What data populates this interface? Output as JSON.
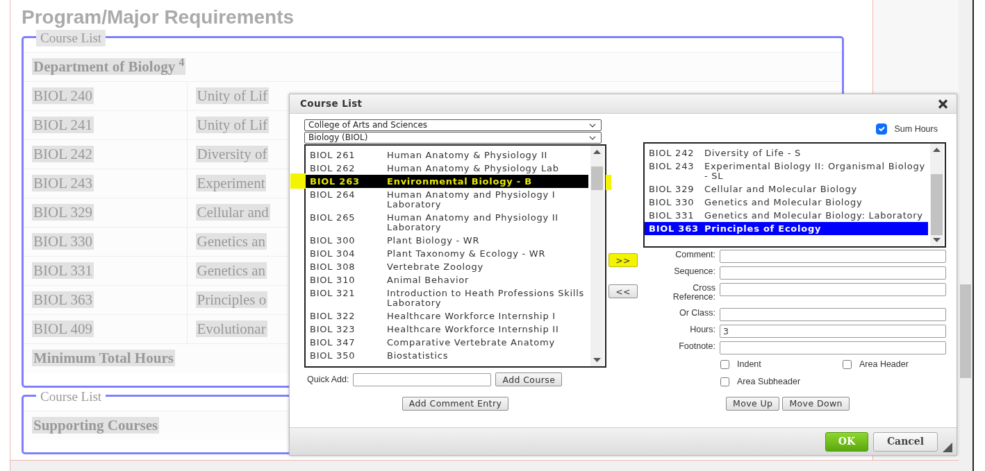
{
  "page": {
    "title": "Program/Major Requirements",
    "sections": [
      {
        "legend": "Course List",
        "heading": "Department of Biology $^{4}$",
        "rows": [
          {
            "code": "BIOL 240",
            "title": "Unity of Lif"
          },
          {
            "code": "BIOL 241",
            "title": "Unity of Lif"
          },
          {
            "code": "BIOL 242",
            "title": "Diversity of"
          },
          {
            "code": "BIOL 243",
            "title": "Experiment"
          },
          {
            "code": "BIOL 329",
            "title": "Cellular and"
          },
          {
            "code": "BIOL 330",
            "title": "Genetics an"
          },
          {
            "code": "BIOL 331",
            "title": "Genetics an"
          },
          {
            "code": "BIOL 363",
            "title": "Principles o"
          },
          {
            "code": "BIOL 409",
            "title": "Evolutionar"
          }
        ],
        "total_label": "Minimum Total Hours"
      },
      {
        "legend": "Course List",
        "heading": "Supporting Courses"
      }
    ]
  },
  "dialog": {
    "title": "Course List",
    "college_select": "College of Arts and Sciences",
    "department_select": "Biology (BIOL)",
    "sum_hours": {
      "label": "Sum Hours",
      "checked": true
    },
    "available_courses": [
      {
        "code": "BIOL 261",
        "title": "Human Anatomy & Physiology II",
        "selected": false
      },
      {
        "code": "BIOL 262",
        "title": "Human Anatomy & Physiology Lab",
        "selected": false
      },
      {
        "code": "BIOL 263",
        "title": "Environmental Biology - B",
        "selected": true
      },
      {
        "code": "BIOL 264",
        "title": "Human Anatomy and Physiology I Laboratory",
        "selected": false
      },
      {
        "code": "BIOL 265",
        "title": "Human Anatomy and Physiology II Laboratory",
        "selected": false
      },
      {
        "code": "BIOL 300",
        "title": "Plant Biology - WR",
        "selected": false
      },
      {
        "code": "BIOL 304",
        "title": "Plant Taxonomy & Ecology - WR",
        "selected": false
      },
      {
        "code": "BIOL 308",
        "title": "Vertebrate Zoology",
        "selected": false
      },
      {
        "code": "BIOL 310",
        "title": "Animal Behavior",
        "selected": false
      },
      {
        "code": "BIOL 321",
        "title": "Introduction to Heath Professions Skills Laboratory",
        "selected": false
      },
      {
        "code": "BIOL 322",
        "title": "Healthcare Workforce Internship I",
        "selected": false
      },
      {
        "code": "BIOL 323",
        "title": "Healthcare Workforce Internship II",
        "selected": false
      },
      {
        "code": "BIOL 347",
        "title": "Comparative Vertebrate Anatomy",
        "selected": false
      },
      {
        "code": "BIOL 350",
        "title": "Biostatistics",
        "selected": false
      }
    ],
    "add_button": ">>",
    "remove_button": "<<",
    "chosen_courses": [
      {
        "code": "BIOL 242",
        "title": "Diversity of Life - S",
        "selected": false
      },
      {
        "code": "BIOL 243",
        "title": "Experimental Biology II: Organismal Biology - SL",
        "selected": false
      },
      {
        "code": "BIOL 329",
        "title": "Cellular and Molecular Biology",
        "selected": false
      },
      {
        "code": "BIOL 330",
        "title": "Genetics and Molecular Biology",
        "selected": false
      },
      {
        "code": "BIOL 331",
        "title": "Genetics and Molecular Biology: Laboratory",
        "selected": false
      },
      {
        "code": "BIOL 363",
        "title": "Principles of Ecology",
        "selected": true
      }
    ],
    "fields": [
      {
        "label": "Comment:"
      },
      {
        "label": "Sequence:"
      },
      {
        "label": "Cross Reference:"
      },
      {
        "label": "Or Class:"
      },
      {
        "label": "Hours:",
        "value": "3"
      },
      {
        "label": "Footnote:"
      }
    ],
    "options": [
      {
        "label": "Indent",
        "checked": false
      },
      {
        "label": "Area Header",
        "checked": false
      },
      {
        "label": "Area Subheader",
        "checked": false
      }
    ],
    "quick_add_label": "Quick Add:",
    "add_course_button": "Add Course",
    "add_comment_button": "Add Comment Entry",
    "move_up_button": "Move Up",
    "move_down_button": "Move Down",
    "ok_button": "OK",
    "cancel_button": "Cancel"
  }
}
